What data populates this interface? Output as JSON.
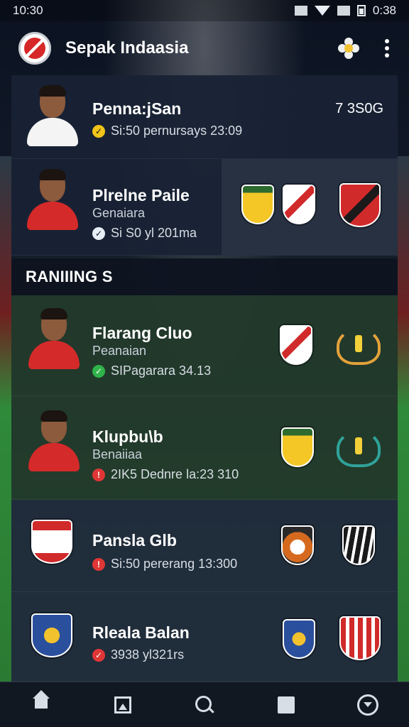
{
  "status_bar": {
    "time": "10:30",
    "battery_time": "0:38"
  },
  "header": {
    "title": "Sepak Indaasia",
    "icons": [
      "app-logo",
      "flower-icon",
      "kebab-menu-icon"
    ]
  },
  "featured": [
    {
      "title": "Penna:jSan",
      "meta": "Si:50 pernursays 23:09",
      "meta_icon": "check-icon",
      "value": "7 3S0G"
    },
    {
      "title": "Plrelne Paile",
      "subtitle": "Genaiara",
      "meta": "Si S0 yl 201ma",
      "meta_icon": "check-icon"
    }
  ],
  "section": {
    "title": "RANIIING S"
  },
  "rankings": [
    {
      "title": "Flarang Cluo",
      "subtitle": "Peanaian",
      "meta": "SIPagarara 34.13",
      "meta_icon": "check-icon"
    },
    {
      "title": "Klupbu\\b",
      "subtitle": "Benaiiaa",
      "meta": "2IK5 Dednre la:23 310",
      "meta_icon": "alert-icon"
    },
    {
      "title": "Pansla Glb",
      "meta": "Si:50 pererang 13:300",
      "meta_icon": "alert-icon"
    },
    {
      "title": "Rleala Balan",
      "meta": "3938 yl321rs",
      "meta_icon": "check-icon"
    }
  ],
  "bottom_nav": {
    "items": [
      "home-icon",
      "gallery-icon",
      "search-icon",
      "square-icon",
      "chevron-circle-icon"
    ]
  },
  "colors": {
    "accent_yellow": "#f0c419",
    "accent_green": "#30b34a",
    "accent_red": "#e03636",
    "card_dark": "#182234"
  }
}
